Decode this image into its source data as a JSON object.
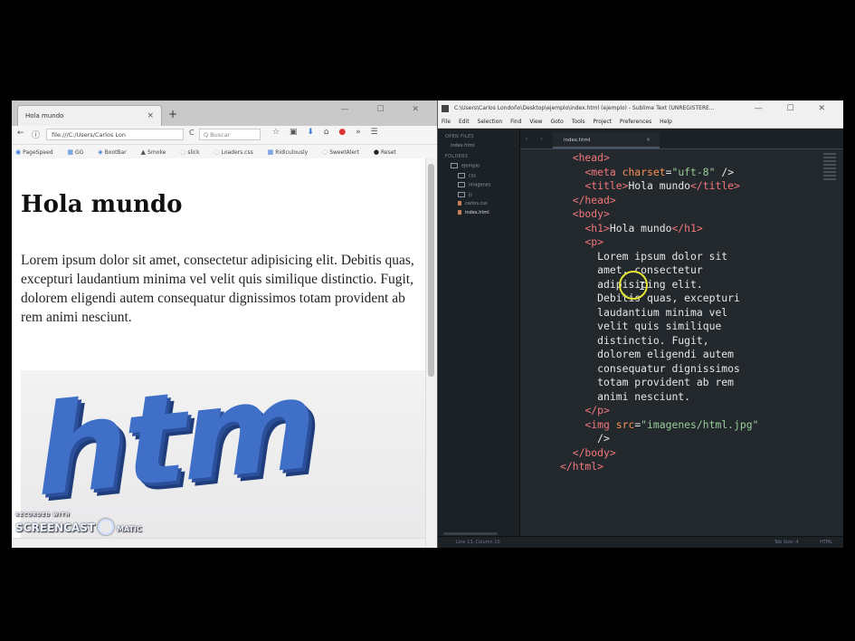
{
  "firefox": {
    "tab_title": "Hola mundo",
    "tab_close": "×",
    "new_tab": "+",
    "window_buttons": "— ☐ ✕",
    "url": "file:///C:/Users/Carlos Lon",
    "reload": "C",
    "search_placeholder": "Q  Buscar",
    "bookmarks": [
      "PageSpeed",
      "GG",
      "BootBar",
      "Smoke",
      "slick",
      "Loaders.css",
      "Ridiculously",
      "SweetAlert",
      "Reset"
    ],
    "toolbar_icons": [
      "star-icon",
      "clipboard-icon",
      "download-icon",
      "home-icon",
      "addon-icon",
      "overflow-icon",
      "menu-icon"
    ]
  },
  "page": {
    "heading": "Hola mundo",
    "paragraph": "Lorem ipsum dolor sit amet, consectetur adipisicing elit. Debitis quas, excepturi laudantium minima vel velit quis similique distinctio. Fugit, dolorem eligendi autem consequatur dignissimos totam provident ab rem animi nesciunt.",
    "image_text": "htm"
  },
  "watermark": {
    "small": "RECORDED WITH",
    "big": "SCREENCAST",
    "suffix": "MATIC"
  },
  "sublime": {
    "title": "C:\\Users\\Carlos Londoño\\Desktop\\ejemplo\\index.html (ejemplo) - Sublime Text (UNREGISTERE...",
    "window_buttons": "— ☐ ✕",
    "menu": [
      "File",
      "Edit",
      "Selection",
      "Find",
      "View",
      "Goto",
      "Tools",
      "Project",
      "Preferences",
      "Help"
    ],
    "sidebar": {
      "open_files_label": "OPEN FILES",
      "open_file": "index.html",
      "folders_label": "FOLDERS",
      "root_folder": "ejemplo",
      "subfolders": [
        "css",
        "imagenes",
        "js"
      ],
      "files": [
        "carlos.css",
        "index.html"
      ]
    },
    "tab_label": "index.html",
    "tab_close": "×",
    "status_left": "Line 13, Column 10",
    "status_right": [
      "Tab Size: 4",
      "HTML"
    ]
  },
  "code_lines": [
    {
      "indent": "  ",
      "parts": [
        {
          "c": "tag",
          "t": "<head>"
        }
      ]
    },
    {
      "indent": "    ",
      "parts": [
        {
          "c": "tag",
          "t": "<meta "
        },
        {
          "c": "attr",
          "t": "charset"
        },
        {
          "c": "txt",
          "t": "="
        },
        {
          "c": "str",
          "t": "\"uft-8\""
        },
        {
          "c": "txt",
          "t": " />"
        }
      ]
    },
    {
      "indent": "    ",
      "parts": [
        {
          "c": "tag",
          "t": "<title>"
        },
        {
          "c": "txt",
          "t": "Hola mundo"
        },
        {
          "c": "tag",
          "t": "</title>"
        }
      ]
    },
    {
      "indent": "  ",
      "parts": [
        {
          "c": "tag",
          "t": "</head>"
        }
      ]
    },
    {
      "indent": "  ",
      "parts": [
        {
          "c": "tag",
          "t": "<body>"
        }
      ]
    },
    {
      "indent": "    ",
      "parts": [
        {
          "c": "tag",
          "t": "<h1>"
        },
        {
          "c": "txt",
          "t": "Hola mundo"
        },
        {
          "c": "tag",
          "t": "</h1>"
        }
      ]
    },
    {
      "indent": "    ",
      "parts": [
        {
          "c": "tag",
          "t": "<p>"
        }
      ]
    },
    {
      "indent": "      ",
      "parts": [
        {
          "c": "txt",
          "t": "Lorem ipsum dolor sit"
        }
      ]
    },
    {
      "indent": "      ",
      "parts": [
        {
          "c": "txt",
          "t": "amet, consectetur"
        }
      ]
    },
    {
      "indent": "      ",
      "parts": [
        {
          "c": "txt",
          "t": "adipisicing elit."
        }
      ]
    },
    {
      "indent": "      ",
      "parts": [
        {
          "c": "txt",
          "t": "Debitis quas, excepturi"
        }
      ]
    },
    {
      "indent": "      ",
      "parts": [
        {
          "c": "txt",
          "t": "laudantium minima vel"
        }
      ]
    },
    {
      "indent": "      ",
      "parts": [
        {
          "c": "txt",
          "t": "velit quis similique"
        }
      ]
    },
    {
      "indent": "      ",
      "parts": [
        {
          "c": "txt",
          "t": "distinctio. Fugit,"
        }
      ]
    },
    {
      "indent": "      ",
      "parts": [
        {
          "c": "txt",
          "t": "dolorem eligendi autem"
        }
      ]
    },
    {
      "indent": "      ",
      "parts": [
        {
          "c": "txt",
          "t": "consequatur dignissimos"
        }
      ]
    },
    {
      "indent": "      ",
      "parts": [
        {
          "c": "txt",
          "t": "totam provident ab rem"
        }
      ]
    },
    {
      "indent": "      ",
      "parts": [
        {
          "c": "txt",
          "t": "animi nesciunt."
        }
      ]
    },
    {
      "indent": "    ",
      "parts": [
        {
          "c": "tag",
          "t": "</p>"
        }
      ]
    },
    {
      "indent": "    ",
      "parts": [
        {
          "c": "tag",
          "t": "<img "
        },
        {
          "c": "attr",
          "t": "src"
        },
        {
          "c": "txt",
          "t": "="
        },
        {
          "c": "str",
          "t": "\"imagenes/html.jpg\""
        }
      ]
    },
    {
      "indent": "      ",
      "parts": [
        {
          "c": "txt",
          "t": "/>"
        }
      ]
    },
    {
      "indent": "  ",
      "parts": [
        {
          "c": "tag",
          "t": "</body>"
        }
      ]
    },
    {
      "indent": "",
      "parts": [
        {
          "c": "tag",
          "t": "</html>"
        }
      ]
    }
  ],
  "line_numbers": [
    "",
    "",
    "",
    "",
    "",
    "",
    "",
    "",
    "",
    "",
    "",
    "",
    "",
    "",
    "",
    "",
    "",
    "",
    "",
    "",
    "",
    "",
    ""
  ]
}
